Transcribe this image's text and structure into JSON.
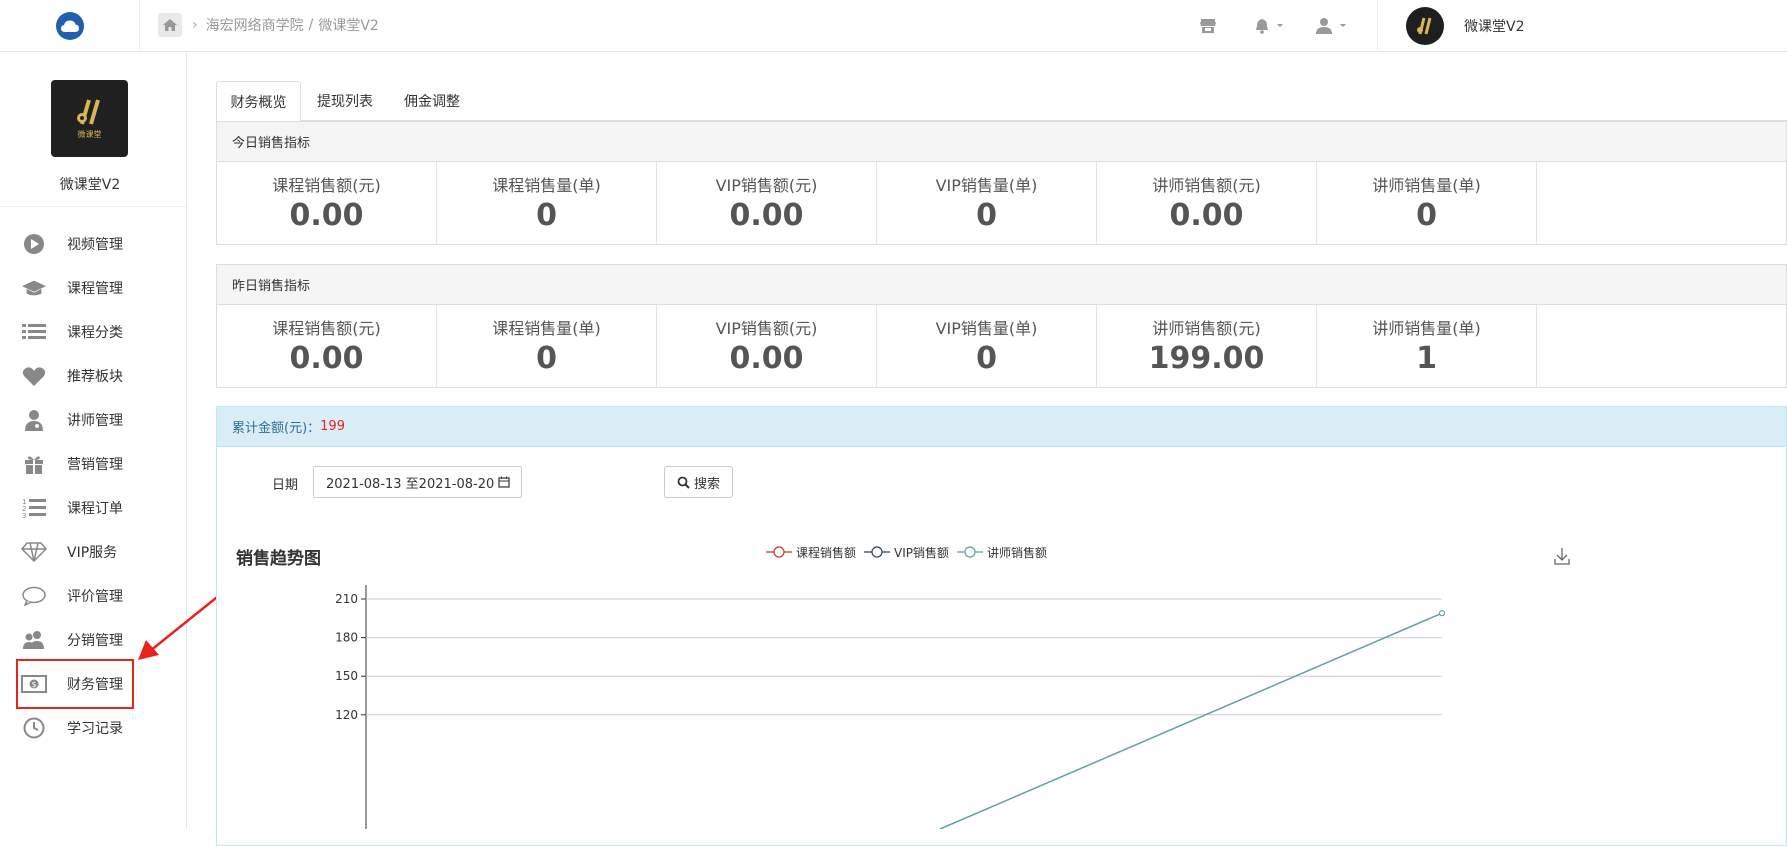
{
  "header": {
    "breadcrumb": {
      "school": "海宏网络商学院",
      "sep": "/",
      "app": "微课堂V2"
    },
    "user_name": "微课堂V2"
  },
  "sidebar": {
    "brand_name": "微课堂V2",
    "logo_caption": "微课堂",
    "items": [
      {
        "label": "视频管理",
        "icon": "play-circle-icon"
      },
      {
        "label": "课程管理",
        "icon": "graduation-cap-icon"
      },
      {
        "label": "课程分类",
        "icon": "list-icon"
      },
      {
        "label": "推荐板块",
        "icon": "heart-icon"
      },
      {
        "label": "讲师管理",
        "icon": "user-md-icon"
      },
      {
        "label": "营销管理",
        "icon": "gift-icon"
      },
      {
        "label": "课程订单",
        "icon": "ordered-list-icon"
      },
      {
        "label": "VIP服务",
        "icon": "diamond-icon"
      },
      {
        "label": "评价管理",
        "icon": "comment-icon"
      },
      {
        "label": "分销管理",
        "icon": "users-icon"
      },
      {
        "label": "财务管理",
        "icon": "money-icon"
      },
      {
        "label": "学习记录",
        "icon": "clock-icon"
      }
    ],
    "highlight_color": "#e8231b"
  },
  "tabs": [
    "财务概览",
    "提现列表",
    "佣金调整"
  ],
  "today": {
    "title": "今日销售指标",
    "stats": [
      {
        "label": "课程销售额(元)",
        "value": "0.00"
      },
      {
        "label": "课程销售量(单)",
        "value": "0"
      },
      {
        "label": "VIP销售额(元)",
        "value": "0.00"
      },
      {
        "label": "VIP销售量(单)",
        "value": "0"
      },
      {
        "label": "讲师销售额(元)",
        "value": "0.00"
      },
      {
        "label": "讲师销售量(单)",
        "value": "0"
      }
    ]
  },
  "yesterday": {
    "title": "昨日销售指标",
    "stats": [
      {
        "label": "课程销售额(元)",
        "value": "0.00"
      },
      {
        "label": "课程销售量(单)",
        "value": "0"
      },
      {
        "label": "VIP销售额(元)",
        "value": "0.00"
      },
      {
        "label": "VIP销售量(单)",
        "value": "0"
      },
      {
        "label": "讲师销售额(元)",
        "value": "199.00"
      },
      {
        "label": "讲师销售量(单)",
        "value": "1"
      }
    ]
  },
  "total": {
    "label": "累计金额(元)：",
    "value": "199"
  },
  "filter": {
    "date_label": "日期",
    "date_value": "2021-08-13 至2021-08-20",
    "search_label": "搜索"
  },
  "chart_data": {
    "type": "line",
    "title": "销售趋势图",
    "series": [
      {
        "name": "课程销售额",
        "color": "#c23531"
      },
      {
        "name": "VIP销售额",
        "color": "#2f4554"
      },
      {
        "name": "讲师销售额",
        "color": "#61a0a8",
        "values_visible": [
          199
        ]
      }
    ],
    "y_ticks": [
      210,
      180,
      150,
      120
    ],
    "ylim": [
      0,
      210
    ]
  }
}
